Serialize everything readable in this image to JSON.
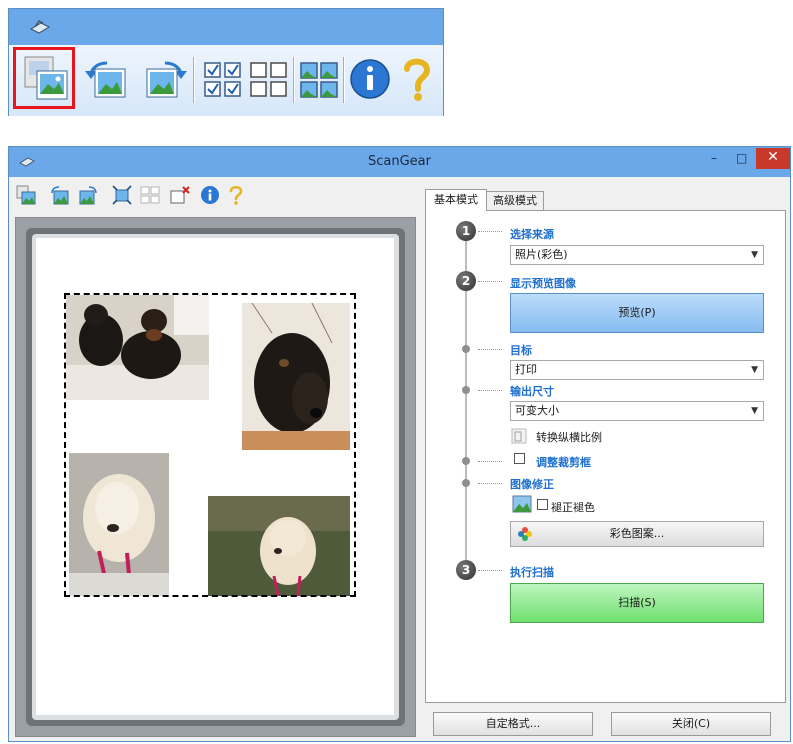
{
  "colors": {
    "titlebar": "#6aa8ea",
    "highlight": "#e8151f",
    "heading_blue": "#1e6fd0",
    "preview_button": "#86bcf2",
    "scan_button": "#6ee06e",
    "close_button": "#c8392b"
  },
  "zoomed_toolbar": {
    "icons": [
      "auto-crop-photo-icon",
      "rotate-left-icon",
      "rotate-right-icon",
      "select-all-frames-icon",
      "clear-frames-icon",
      "multi-crop-icon",
      "info-icon",
      "help-icon"
    ],
    "highlighted": "auto-crop-photo-icon"
  },
  "window": {
    "title": "ScanGear",
    "minimize": "–",
    "maximize": "□",
    "close": "✕"
  },
  "toolbar": {
    "icons": [
      "auto-crop-photo-icon",
      "rotate-left-icon",
      "rotate-right-icon",
      "auto-crop-icon",
      "multi-crop-icon",
      "remove-crop-icon",
      "info-icon",
      "help-icon"
    ]
  },
  "tabs": {
    "basic": "基本模式",
    "advanced": "高级模式"
  },
  "steps": {
    "step1": {
      "number": "1",
      "heading": "选择来源",
      "value": "照片(彩色)"
    },
    "step2": {
      "number": "2",
      "heading": "显示预览图像",
      "button": "预览(P)"
    },
    "destination": {
      "heading": "目标",
      "value": "打印"
    },
    "output_size": {
      "heading": "输出尺寸",
      "value": "可变大小"
    },
    "swap_aspect": "转换纵横比例",
    "adjust_crop": "调整裁剪框",
    "image_correction": {
      "heading": "图像修正",
      "fix_fading": "褪正褪色",
      "color_pattern": "彩色图案..."
    },
    "step3": {
      "number": "3",
      "heading": "执行扫描",
      "button": "扫描(S)"
    }
  },
  "bottom": {
    "custom": "自定格式...",
    "close": "关闭(C)"
  }
}
